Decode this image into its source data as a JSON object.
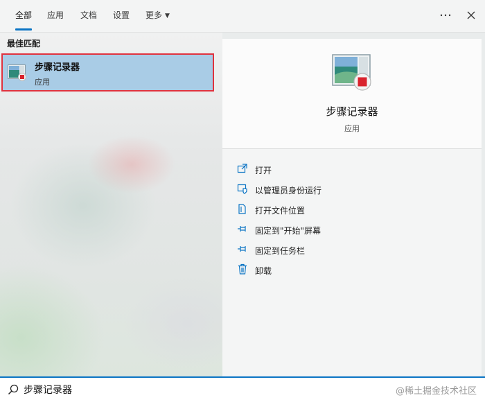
{
  "tabs": [
    {
      "label": "全部",
      "active": true
    },
    {
      "label": "应用"
    },
    {
      "label": "文档"
    },
    {
      "label": "设置"
    },
    {
      "label": "更多"
    }
  ],
  "top_icons": {
    "more": "ellipsis-icon",
    "close": "close-icon"
  },
  "results": {
    "section_label": "最佳匹配",
    "best_match": {
      "name": "步骤记录器",
      "type": "应用",
      "icon": "steps-recorder-app-icon"
    }
  },
  "detail": {
    "title": "步骤记录器",
    "subtitle": "应用",
    "actions": [
      {
        "label": "打开",
        "icon": "open-icon"
      },
      {
        "label": "以管理员身份运行",
        "icon": "run-as-admin-icon"
      },
      {
        "label": "打开文件位置",
        "icon": "file-location-icon"
      },
      {
        "label": "固定到\"开始\"屏幕",
        "icon": "pin-icon"
      },
      {
        "label": "固定到任务栏",
        "icon": "pin-icon"
      },
      {
        "label": "卸载",
        "icon": "trash-icon"
      }
    ]
  },
  "search": {
    "value": "步骤记录器",
    "watermark": "@稀土掘金技术社区"
  },
  "colors": {
    "accent": "#0a74c4",
    "highlight": "#a9cce6",
    "annotation_border": "#e0323e"
  }
}
